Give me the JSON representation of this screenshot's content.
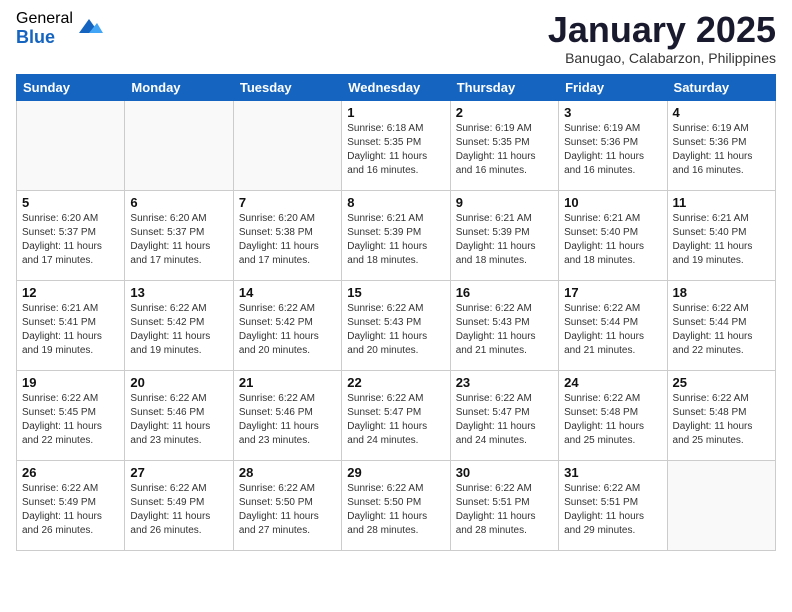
{
  "logo": {
    "general": "General",
    "blue": "Blue"
  },
  "title": "January 2025",
  "location": "Banugao, Calabarzon, Philippines",
  "weekdays": [
    "Sunday",
    "Monday",
    "Tuesday",
    "Wednesday",
    "Thursday",
    "Friday",
    "Saturday"
  ],
  "weeks": [
    [
      {
        "day": "",
        "sunrise": "",
        "sunset": "",
        "daylight": ""
      },
      {
        "day": "",
        "sunrise": "",
        "sunset": "",
        "daylight": ""
      },
      {
        "day": "",
        "sunrise": "",
        "sunset": "",
        "daylight": ""
      },
      {
        "day": "1",
        "sunrise": "6:18 AM",
        "sunset": "5:35 PM",
        "daylight": "11 hours and 16 minutes."
      },
      {
        "day": "2",
        "sunrise": "6:19 AM",
        "sunset": "5:35 PM",
        "daylight": "11 hours and 16 minutes."
      },
      {
        "day": "3",
        "sunrise": "6:19 AM",
        "sunset": "5:36 PM",
        "daylight": "11 hours and 16 minutes."
      },
      {
        "day": "4",
        "sunrise": "6:19 AM",
        "sunset": "5:36 PM",
        "daylight": "11 hours and 16 minutes."
      }
    ],
    [
      {
        "day": "5",
        "sunrise": "6:20 AM",
        "sunset": "5:37 PM",
        "daylight": "11 hours and 17 minutes."
      },
      {
        "day": "6",
        "sunrise": "6:20 AM",
        "sunset": "5:37 PM",
        "daylight": "11 hours and 17 minutes."
      },
      {
        "day": "7",
        "sunrise": "6:20 AM",
        "sunset": "5:38 PM",
        "daylight": "11 hours and 17 minutes."
      },
      {
        "day": "8",
        "sunrise": "6:21 AM",
        "sunset": "5:39 PM",
        "daylight": "11 hours and 18 minutes."
      },
      {
        "day": "9",
        "sunrise": "6:21 AM",
        "sunset": "5:39 PM",
        "daylight": "11 hours and 18 minutes."
      },
      {
        "day": "10",
        "sunrise": "6:21 AM",
        "sunset": "5:40 PM",
        "daylight": "11 hours and 18 minutes."
      },
      {
        "day": "11",
        "sunrise": "6:21 AM",
        "sunset": "5:40 PM",
        "daylight": "11 hours and 19 minutes."
      }
    ],
    [
      {
        "day": "12",
        "sunrise": "6:21 AM",
        "sunset": "5:41 PM",
        "daylight": "11 hours and 19 minutes."
      },
      {
        "day": "13",
        "sunrise": "6:22 AM",
        "sunset": "5:42 PM",
        "daylight": "11 hours and 19 minutes."
      },
      {
        "day": "14",
        "sunrise": "6:22 AM",
        "sunset": "5:42 PM",
        "daylight": "11 hours and 20 minutes."
      },
      {
        "day": "15",
        "sunrise": "6:22 AM",
        "sunset": "5:43 PM",
        "daylight": "11 hours and 20 minutes."
      },
      {
        "day": "16",
        "sunrise": "6:22 AM",
        "sunset": "5:43 PM",
        "daylight": "11 hours and 21 minutes."
      },
      {
        "day": "17",
        "sunrise": "6:22 AM",
        "sunset": "5:44 PM",
        "daylight": "11 hours and 21 minutes."
      },
      {
        "day": "18",
        "sunrise": "6:22 AM",
        "sunset": "5:44 PM",
        "daylight": "11 hours and 22 minutes."
      }
    ],
    [
      {
        "day": "19",
        "sunrise": "6:22 AM",
        "sunset": "5:45 PM",
        "daylight": "11 hours and 22 minutes."
      },
      {
        "day": "20",
        "sunrise": "6:22 AM",
        "sunset": "5:46 PM",
        "daylight": "11 hours and 23 minutes."
      },
      {
        "day": "21",
        "sunrise": "6:22 AM",
        "sunset": "5:46 PM",
        "daylight": "11 hours and 23 minutes."
      },
      {
        "day": "22",
        "sunrise": "6:22 AM",
        "sunset": "5:47 PM",
        "daylight": "11 hours and 24 minutes."
      },
      {
        "day": "23",
        "sunrise": "6:22 AM",
        "sunset": "5:47 PM",
        "daylight": "11 hours and 24 minutes."
      },
      {
        "day": "24",
        "sunrise": "6:22 AM",
        "sunset": "5:48 PM",
        "daylight": "11 hours and 25 minutes."
      },
      {
        "day": "25",
        "sunrise": "6:22 AM",
        "sunset": "5:48 PM",
        "daylight": "11 hours and 25 minutes."
      }
    ],
    [
      {
        "day": "26",
        "sunrise": "6:22 AM",
        "sunset": "5:49 PM",
        "daylight": "11 hours and 26 minutes."
      },
      {
        "day": "27",
        "sunrise": "6:22 AM",
        "sunset": "5:49 PM",
        "daylight": "11 hours and 26 minutes."
      },
      {
        "day": "28",
        "sunrise": "6:22 AM",
        "sunset": "5:50 PM",
        "daylight": "11 hours and 27 minutes."
      },
      {
        "day": "29",
        "sunrise": "6:22 AM",
        "sunset": "5:50 PM",
        "daylight": "11 hours and 28 minutes."
      },
      {
        "day": "30",
        "sunrise": "6:22 AM",
        "sunset": "5:51 PM",
        "daylight": "11 hours and 28 minutes."
      },
      {
        "day": "31",
        "sunrise": "6:22 AM",
        "sunset": "5:51 PM",
        "daylight": "11 hours and 29 minutes."
      },
      {
        "day": "",
        "sunrise": "",
        "sunset": "",
        "daylight": ""
      }
    ]
  ],
  "labels": {
    "sunrise_prefix": "Sunrise: ",
    "sunset_prefix": "Sunset: ",
    "daylight_prefix": "Daylight: "
  }
}
